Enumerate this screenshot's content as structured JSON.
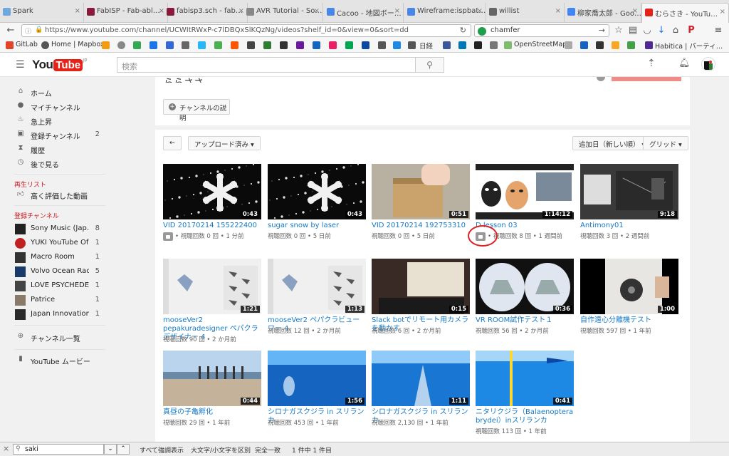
{
  "browser": {
    "tabs": [
      {
        "label": "Spark",
        "icon": "spark-icon",
        "color": "#6fa8dc"
      },
      {
        "label": "FabISP - Fab-abl…",
        "icon": "grid-icon",
        "color": "#8a1a3a"
      },
      {
        "label": "fabisp3.sch - fab…",
        "icon": "grid-icon",
        "color": "#8a1a3a"
      },
      {
        "label": "AVR Tutorial - So…",
        "icon": "avatar-icon",
        "color": "#888888"
      },
      {
        "label": "Cacoo - 地図ボー…",
        "icon": "cacoo-icon",
        "color": "#4a86e8"
      },
      {
        "label": "Wireframe:ispbat…",
        "icon": "cacoo-icon",
        "color": "#4a86e8"
      },
      {
        "label": "willist",
        "icon": "info-icon",
        "color": "#666666"
      },
      {
        "label": "柳家喬太郎 - Goo…",
        "icon": "google-icon",
        "color": "#4285f4"
      },
      {
        "label": "むらさき - YouTu…",
        "icon": "youtube-icon",
        "color": "#e62117",
        "active": true
      }
    ],
    "url": "https://www.youtube.com/channel/UCWItRWxP-c7lDBQxSlKQzNg/videos?shelf_id=0&view=0&sort=dd",
    "search_value": "chamfer",
    "bookmarks": [
      "GitLab",
      "Home | Mapbox",
      "日経",
      "OpenStreetMap",
      "Habitica | パーティ…"
    ]
  },
  "youtube": {
    "logo_you": "You",
    "logo_tube": "Tube",
    "logo_region": "JP",
    "search_placeholder": "検索",
    "sidebar": {
      "main": [
        {
          "label": "ホーム",
          "icon": "home-icon"
        },
        {
          "label": "マイチャンネル",
          "icon": "person-icon"
        },
        {
          "label": "急上昇",
          "icon": "flame-icon"
        },
        {
          "label": "登録チャンネル",
          "icon": "subscriptions-icon",
          "count": "2"
        },
        {
          "label": "履歴",
          "icon": "hourglass-icon"
        },
        {
          "label": "後で見る",
          "icon": "clock-icon"
        }
      ],
      "playlist_heading": "再生リスト",
      "playlists": [
        {
          "label": "高く評価した動画",
          "icon": "thumbs-up-icon"
        }
      ],
      "subs_heading": "登録チャンネル",
      "subscriptions": [
        {
          "label": "Sony Music (Jap…",
          "count": "8",
          "color": "#222222"
        },
        {
          "label": "YUKI YouTube Of…",
          "count": "1",
          "color": "#c02020"
        },
        {
          "label": "Macro Room",
          "count": "1",
          "color": "#333333"
        },
        {
          "label": "Volvo Ocean Race",
          "count": "5",
          "color": "#1a3a6a"
        },
        {
          "label": "LOVE PSYCHEDE…",
          "count": "1",
          "color": "#444444"
        },
        {
          "label": "Patrice",
          "count": "1",
          "color": "#8a7a6a"
        },
        {
          "label": "Japan Innovation…",
          "count": "1",
          "color": "#2a2a2a"
        }
      ],
      "browse_channels": "チャンネル一覧",
      "movies": "YouTube ムービー"
    },
    "desc_button": "チャンネルの説明",
    "toolbar": {
      "back": "←",
      "filter": "アップロード済み",
      "sort": "追加日（新しい順）",
      "view": "グリッド"
    },
    "videos": [
      {
        "title": "VID 20170214 155222400",
        "meta": "視聴回数 0 回 • 1 分前",
        "duration": "0:43",
        "locked": true,
        "thumb": "snow"
      },
      {
        "title": "sugar snow by laser",
        "meta": "視聴回数 0 回 • 5 日前",
        "duration": "0:43",
        "thumb": "snow"
      },
      {
        "title": "VID 20170214 192753310",
        "meta": "視聴回数 0 回 • 5 日前",
        "duration": "0:51",
        "thumb": "box"
      },
      {
        "title": "D lesson 03",
        "meta": "視聴回数 8 回 • 1 週間前",
        "duration": "1:14:12",
        "locked": true,
        "thumb": "masks"
      },
      {
        "title": "Antimony01",
        "meta": "視聴回数 3 回 • 2 週間前",
        "duration": "9:18",
        "thumb": "nodes"
      },
      {
        "title": "mooseVer2 pepakuradesigner ペパクラデザイナー 4",
        "meta": "視聴回数 90 回 • 2 か月前",
        "duration": "1:21",
        "thumb": "paper"
      },
      {
        "title": "mooseVer2 ペパクラビューワー 4",
        "meta": "視聴回数 12 回 • 2 か月前",
        "duration": "1:13",
        "thumb": "paper"
      },
      {
        "title": "Slack botでリモート用カメラを動かす",
        "meta": "視聴回数 6 回 • 2 か月前",
        "duration": "0:15",
        "thumb": "desk"
      },
      {
        "title": "VR ROOM試作テスト１",
        "meta": "視聴回数 56 回 • 2 か月前",
        "duration": "0:36",
        "thumb": "vr"
      },
      {
        "title": "自作遠心分離機テスト",
        "meta": "視聴回数 597 回 • 1 年前",
        "duration": "1:00",
        "thumb": "centrifuge"
      },
      {
        "title": "真昼の子亀孵化",
        "meta": "視聴回数 29 回 • 1 年前",
        "duration": "0:44",
        "thumb": "beach"
      },
      {
        "title": "シロナガスクジラ in スリランカ",
        "meta": "視聴回数 453 回 • 1 年前",
        "duration": "1:56",
        "thumb": "ocean"
      },
      {
        "title": "シロナガスクジラ in スリランカ",
        "meta": "視聴回数 2,130 回 • 1 年前",
        "duration": "1:11",
        "thumb": "ocean2"
      },
      {
        "title": "ニタリクジラ（Balaenoptera brydei）inスリランカ",
        "meta": "視聴回数 113 回 • 1 年前",
        "duration": "0:41",
        "thumb": "ocean3"
      }
    ]
  },
  "findbar": {
    "value": "saki",
    "highlight_all": "すべて強調表示",
    "match_case": "大文字/小文字を区別",
    "whole_word": "完全一致",
    "result": "1 件中 1 件目"
  }
}
